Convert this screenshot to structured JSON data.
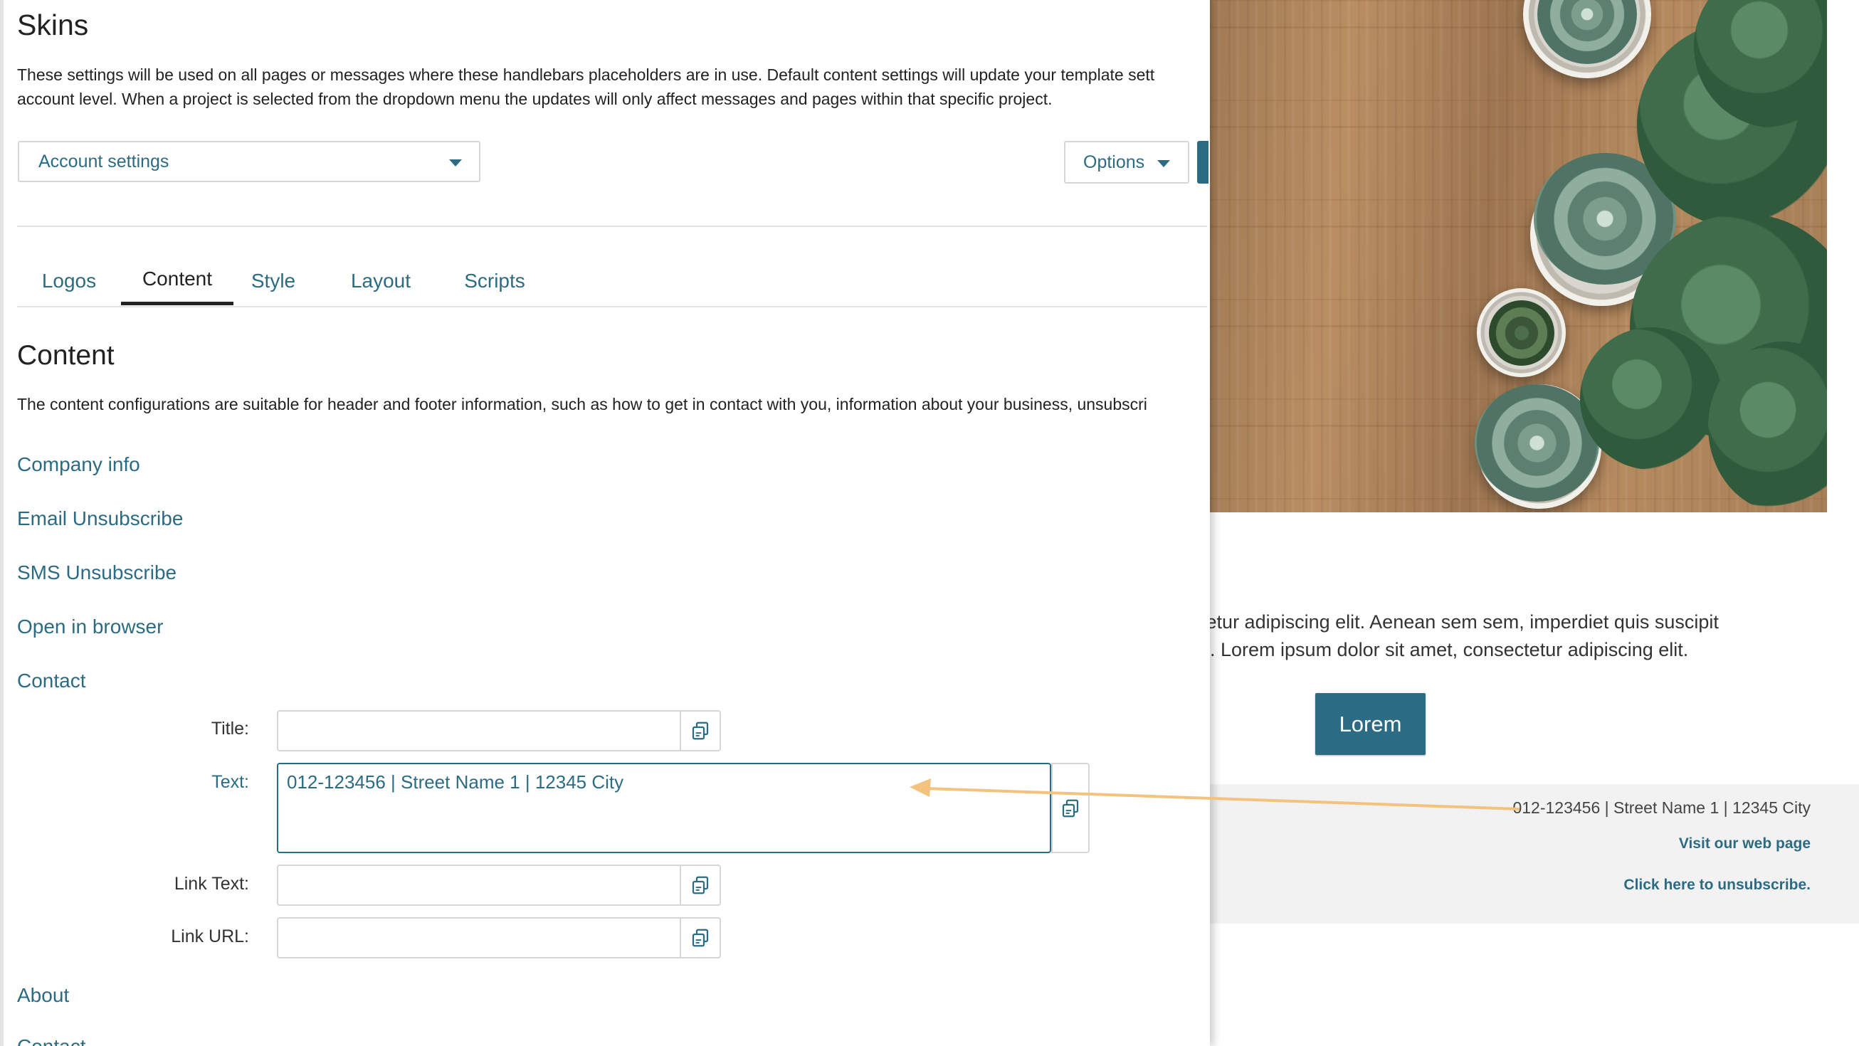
{
  "page": {
    "title": "Skins",
    "description_line1": "These settings will be used on all pages or messages where these handlebars placeholders are in use. Default content settings will update your template sett",
    "description_line2": "account level. When a project is selected from the dropdown menu the updates will only affect messages and pages within that specific project."
  },
  "toolbar": {
    "project_select_value": "Account settings",
    "options_label": "Options"
  },
  "tabs": [
    {
      "label": "Logos",
      "active": false
    },
    {
      "label": "Content",
      "active": true
    },
    {
      "label": "Style",
      "active": false
    },
    {
      "label": "Layout",
      "active": false
    },
    {
      "label": "Scripts",
      "active": false
    }
  ],
  "content": {
    "title": "Content",
    "description": "The content configurations are suitable for header and footer information, such as how to get in contact with you, information about your business, unsubscri",
    "groups": [
      "Company info",
      "Email Unsubscribe",
      "SMS Unsubscribe",
      "Open in browser",
      "Contact",
      "About",
      "Contact"
    ],
    "contact_fields": {
      "title_label": "Title:",
      "title_value": "",
      "text_label": "Text:",
      "text_value": "012-123456 | Street Name 1 | 12345 City",
      "link_text_label": "Link Text:",
      "link_text_value": "",
      "link_url_label": "Link URL:",
      "link_url_value": ""
    }
  },
  "preview": {
    "body_line1": "nsectetur adipiscing elit. Aenean sem sem, imperdiet quis suscipit",
    "body_line2": ". Lorem ipsum dolor sit amet, consectetur adipiscing elit.",
    "button_label": "Lorem",
    "footer_contact": "012-123456 | Street Name 1 | 12345 City",
    "footer_visit_link": "Visit our web page",
    "footer_unsubscribe_link": "Click here to unsubscribe."
  },
  "colors": {
    "accent": "#2c6b84",
    "arrow": "#f2c27e",
    "footer_bg": "#f2f2f2"
  },
  "icons": {
    "copy": "copy-icon",
    "dropdown": "chevron-down-icon"
  }
}
